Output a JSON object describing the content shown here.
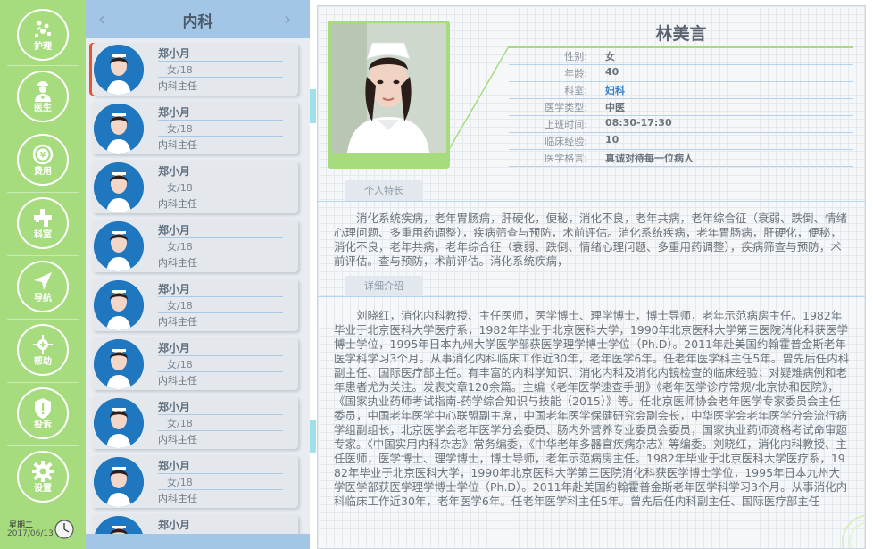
{
  "nav": {
    "items": [
      {
        "label": "护理",
        "icon": "care-icon"
      },
      {
        "label": "医生",
        "icon": "doctor-icon"
      },
      {
        "label": "费用",
        "icon": "fee-icon"
      },
      {
        "label": "科室",
        "icon": "department-icon"
      },
      {
        "label": "导航",
        "icon": "navigation-icon"
      },
      {
        "label": "帮助",
        "icon": "help-icon"
      },
      {
        "label": "投诉",
        "icon": "complaint-icon"
      },
      {
        "label": "设置",
        "icon": "settings-icon"
      }
    ],
    "weekday": "星期二",
    "date": "2017/06/13"
  },
  "list": {
    "title": "内科",
    "doctors": [
      {
        "name": "郑小月",
        "info": "女/18",
        "title": "内科主任"
      },
      {
        "name": "郑小月",
        "info": "女/18",
        "title": "内科主任"
      },
      {
        "name": "郑小月",
        "info": "女/18",
        "title": "内科主任"
      },
      {
        "name": "郑小月",
        "info": "女/18",
        "title": "内科主任"
      },
      {
        "name": "郑小月",
        "info": "女/18",
        "title": "内科主任"
      },
      {
        "name": "郑小月",
        "info": "女/18",
        "title": "内科主任"
      },
      {
        "name": "郑小月",
        "info": "女/18",
        "title": "内科主任"
      },
      {
        "name": "郑小月",
        "info": "女/18",
        "title": "内科主任"
      },
      {
        "name": "郑小月",
        "info": "",
        "title": ""
      }
    ]
  },
  "detail": {
    "name": "林美言",
    "fields": [
      {
        "label": "性别:",
        "value": "女"
      },
      {
        "label": "年龄:",
        "value": "40"
      },
      {
        "label": "科室:",
        "value": "妇科"
      },
      {
        "label": "医学类型:",
        "value": "中医"
      },
      {
        "label": "上班时间:",
        "value": "08:30-17:30"
      },
      {
        "label": "临床经验:",
        "value": "10"
      },
      {
        "label": "医学格言:",
        "value": "真诚对待每一位病人"
      }
    ],
    "specialty_tab": "个人特长",
    "specialty_text": "消化系统疾病，老年胃肠病，肝硬化，便秘，消化不良，老年共病，老年综合征（衰弱、跌倒、情绪心理问题、多重用药调整），疾病筛查与预防，术前评估。消化系统疾病，老年胃肠病，肝硬化，便秘，消化不良，老年共病，老年综合征（衰弱、跌倒、情绪心理问题、多重用药调整），疾病筛查与预防，术前评估。查与预防，术前评估。消化系统疾病，",
    "intro_tab": "详细介绍",
    "intro_text": "刘晓红，消化内科教授、主任医师，医学博士、理学博士，博士导师，老年示范病房主任。1982年毕业于北京医科大学医疗系，1982年毕业于北京医科大学，1990年北京医科大学第三医院消化科获医学博士学位，1995年日本九州大学医学部获医学理学博士学位（Ph.D）。2011年赴美国约翰霍普金斯老年医学科学习3个月。从事消化内科临床工作近30年，老年医学6年。任老年医学科主任5年。曾先后任内科副主任、国际医疗部主任。有丰富的内科学知识、消化内科及消化内镜检查的临床经验；对疑难病例和老年患者尤为关注。发表文章120余篇。主编《老年医学速查手册》《老年医学诊疗常规/北京协和医院》，《国家执业药师考试指南-药学综合知识与技能（2015）》等。任北京医师协会老年医学专家委员会主任委员，中国老年医学中心联盟副主席，中国老年医学保健研究会副会长，中华医学会老年医学分会流行病学组副组长，北京医学会老年医学分会委员、肠内外营养专业委员会委员，国家执业药师资格考试命审题专家。《中国实用内科杂志》常务编委，《中华老年多器官疾病杂志》等编委。刘晓红，消化内科教授、主任医师，医学博士、理学博士，博士导师，老年示范病房主任。1982年毕业于北京医科大学医疗系，1982年毕业于北京医科大学，1990年北京医科大学第三医院消化科获医学博士学位，1995年日本九州大学医学部获医学理学博士学位（Ph.D）。2011年赴美国约翰霍普金斯老年医学科学习3个月。从事消化内科临床工作近30年，老年医学6年。任老年医学科主任5年。曾先后任内科副主任、国际医疗部主任"
  },
  "colors": {
    "nav_green": "#a6dc7e",
    "list_header_blue": "#a3c6e6",
    "avatar_blue": "#1f77c0",
    "selected_marker": "#e6552d"
  }
}
